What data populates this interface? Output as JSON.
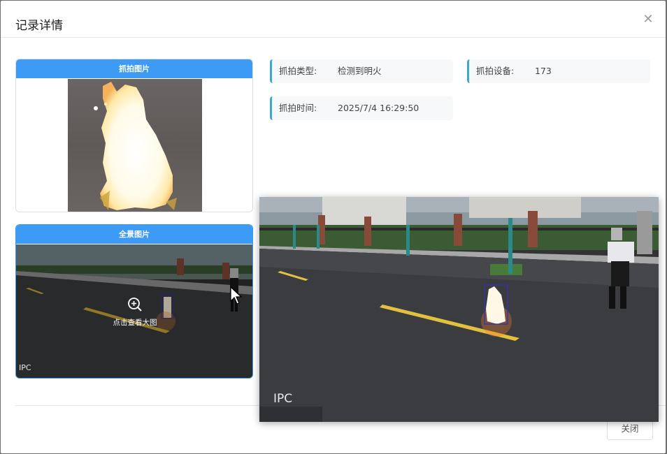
{
  "dialog": {
    "title": "记录详情",
    "close_icon": "close-icon"
  },
  "capture_card": {
    "title": "抓拍图片"
  },
  "panorama_card": {
    "title": "全景图片",
    "zoom_hint": "点击查看大图",
    "watermark": "IPC",
    "zoom_icon": "zoom-in-icon"
  },
  "fields": {
    "capture_type": {
      "label": "抓拍类型:",
      "value": "检测到明火"
    },
    "capture_device": {
      "label": "抓拍设备:",
      "value": "173"
    },
    "capture_time": {
      "label": "抓拍时间:",
      "value": "2025/7/4 16:29:50"
    }
  },
  "footer": {
    "close_label": "关闭"
  },
  "preview": {
    "watermark": "IPC"
  },
  "colors": {
    "accent": "#3d9bf6",
    "field_border": "#3fa7c9",
    "detection_box": "#3a2fb8",
    "road_line": "#e8c23a"
  }
}
